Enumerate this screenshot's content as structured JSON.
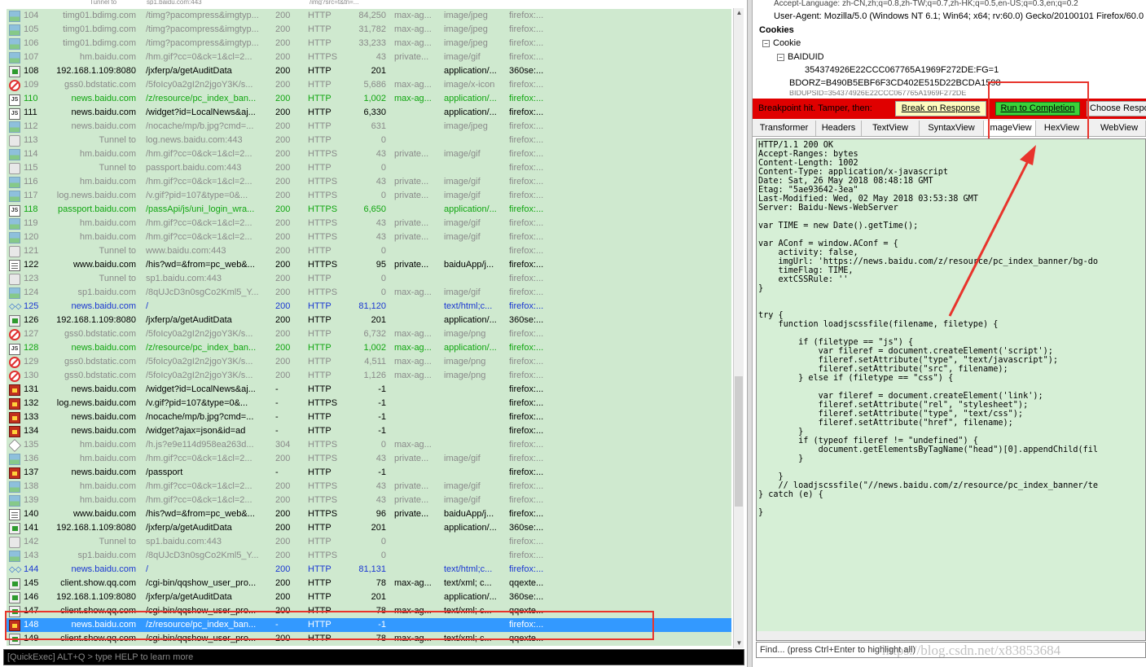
{
  "top_cut": [
    "Tunnel to",
    "sp1.baidu.com:443",
    "/img?src=t&tn=..."
  ],
  "sessions": [
    {
      "num": "104",
      "host": "timg01.bdimg.com",
      "url": "/timg?pacompress&imgtyp...",
      "result": "200",
      "protocol": "HTTP",
      "body": "84,250",
      "caching": "max-ag...",
      "ctype": "image/jpeg",
      "process": "firefox:...",
      "icon": "img",
      "style": "gry"
    },
    {
      "num": "105",
      "host": "timg01.bdimg.com",
      "url": "/timg?pacompress&imgtyp...",
      "result": "200",
      "protocol": "HTTP",
      "body": "31,782",
      "caching": "max-ag...",
      "ctype": "image/jpeg",
      "process": "firefox:...",
      "icon": "img",
      "style": "gry"
    },
    {
      "num": "106",
      "host": "timg01.bdimg.com",
      "url": "/timg?pacompress&imgtyp...",
      "result": "200",
      "protocol": "HTTP",
      "body": "33,233",
      "caching": "max-ag...",
      "ctype": "image/jpeg",
      "process": "firefox:...",
      "icon": "img",
      "style": "gry"
    },
    {
      "num": "107",
      "host": "hm.baidu.com",
      "url": "/hm.gif?cc=0&ck=1&cl=2...",
      "result": "200",
      "protocol": "HTTPS",
      "body": "43",
      "caching": "private...",
      "ctype": "image/gif",
      "process": "firefox:...",
      "icon": "img",
      "style": "gry"
    },
    {
      "num": "108",
      "host": "192.168.1.109:8080",
      "url": "/jxferp/a/getAuditData",
      "result": "200",
      "protocol": "HTTP",
      "body": "201",
      "caching": "",
      "ctype": "application/...",
      "process": "360se:...",
      "icon": "post",
      "style": "blk"
    },
    {
      "num": "109",
      "host": "gss0.bdstatic.com",
      "url": "/5foIcy0a2gI2n2jgoY3K/s...",
      "result": "200",
      "protocol": "HTTP",
      "body": "5,686",
      "caching": "max-ag...",
      "ctype": "image/x-icon",
      "process": "firefox:...",
      "icon": "blocked",
      "style": "gry"
    },
    {
      "num": "110",
      "host": "news.baidu.com",
      "url": "/z/resource/pc_index_ban...",
      "result": "200",
      "protocol": "HTTP",
      "body": "1,002",
      "caching": "max-ag...",
      "ctype": "application/...",
      "process": "firefox:...",
      "icon": "js",
      "style": "grn"
    },
    {
      "num": "111",
      "host": "news.baidu.com",
      "url": "/widget?id=LocalNews&aj...",
      "result": "200",
      "protocol": "HTTP",
      "body": "6,330",
      "caching": "",
      "ctype": "application/...",
      "process": "firefox:...",
      "icon": "js",
      "style": "blk"
    },
    {
      "num": "112",
      "host": "news.baidu.com",
      "url": "/nocache/mp/b.jpg?cmd=...",
      "result": "200",
      "protocol": "HTTP",
      "body": "631",
      "caching": "",
      "ctype": "image/jpeg",
      "process": "firefox:...",
      "icon": "img",
      "style": "gry"
    },
    {
      "num": "113",
      "host": "Tunnel to",
      "url": "log.news.baidu.com:443",
      "result": "200",
      "protocol": "HTTP",
      "body": "0",
      "caching": "",
      "ctype": "",
      "process": "firefox:...",
      "icon": "lock",
      "style": "gry"
    },
    {
      "num": "114",
      "host": "hm.baidu.com",
      "url": "/hm.gif?cc=0&ck=1&cl=2...",
      "result": "200",
      "protocol": "HTTPS",
      "body": "43",
      "caching": "private...",
      "ctype": "image/gif",
      "process": "firefox:...",
      "icon": "img",
      "style": "gry"
    },
    {
      "num": "115",
      "host": "Tunnel to",
      "url": "passport.baidu.com:443",
      "result": "200",
      "protocol": "HTTP",
      "body": "0",
      "caching": "",
      "ctype": "",
      "process": "firefox:...",
      "icon": "lock",
      "style": "gry"
    },
    {
      "num": "116",
      "host": "hm.baidu.com",
      "url": "/hm.gif?cc=0&ck=1&cl=2...",
      "result": "200",
      "protocol": "HTTPS",
      "body": "43",
      "caching": "private...",
      "ctype": "image/gif",
      "process": "firefox:...",
      "icon": "img",
      "style": "gry"
    },
    {
      "num": "117",
      "host": "log.news.baidu.com",
      "url": "/v.gif?pid=107&type=0&...",
      "result": "200",
      "protocol": "HTTPS",
      "body": "0",
      "caching": "private...",
      "ctype": "image/gif",
      "process": "firefox:...",
      "icon": "img",
      "style": "gry"
    },
    {
      "num": "118",
      "host": "passport.baidu.com",
      "url": "/passApi/js/uni_login_wra...",
      "result": "200",
      "protocol": "HTTPS",
      "body": "6,650",
      "caching": "",
      "ctype": "application/...",
      "process": "firefox:...",
      "icon": "js",
      "style": "grn"
    },
    {
      "num": "119",
      "host": "hm.baidu.com",
      "url": "/hm.gif?cc=0&ck=1&cl=2...",
      "result": "200",
      "protocol": "HTTPS",
      "body": "43",
      "caching": "private...",
      "ctype": "image/gif",
      "process": "firefox:...",
      "icon": "img",
      "style": "gry"
    },
    {
      "num": "120",
      "host": "hm.baidu.com",
      "url": "/hm.gif?cc=0&ck=1&cl=2...",
      "result": "200",
      "protocol": "HTTPS",
      "body": "43",
      "caching": "private...",
      "ctype": "image/gif",
      "process": "firefox:...",
      "icon": "img",
      "style": "gry"
    },
    {
      "num": "121",
      "host": "Tunnel to",
      "url": "www.baidu.com:443",
      "result": "200",
      "protocol": "HTTP",
      "body": "0",
      "caching": "",
      "ctype": "",
      "process": "firefox:...",
      "icon": "lock",
      "style": "gry"
    },
    {
      "num": "122",
      "host": "www.baidu.com",
      "url": "/his?wd=&from=pc_web&...",
      "result": "200",
      "protocol": "HTTPS",
      "body": "95",
      "caching": "private...",
      "ctype": "baiduApp/j...",
      "process": "firefox:...",
      "icon": "doc",
      "style": "blk"
    },
    {
      "num": "123",
      "host": "Tunnel to",
      "url": "sp1.baidu.com:443",
      "result": "200",
      "protocol": "HTTP",
      "body": "0",
      "caching": "",
      "ctype": "",
      "process": "firefox:...",
      "icon": "lock",
      "style": "gry"
    },
    {
      "num": "124",
      "host": "sp1.baidu.com",
      "url": "/8qUJcD3n0sgCo2Kml5_Y...",
      "result": "200",
      "protocol": "HTTPS",
      "body": "0",
      "caching": "max-ag...",
      "ctype": "image/gif",
      "process": "firefox:...",
      "icon": "img",
      "style": "gry"
    },
    {
      "num": "125",
      "host": "news.baidu.com",
      "url": "/",
      "result": "200",
      "protocol": "HTTP",
      "body": "81,120",
      "caching": "",
      "ctype": "text/html;c...",
      "process": "firefox:...",
      "icon": "html",
      "style": "blu"
    },
    {
      "num": "126",
      "host": "192.168.1.109:8080",
      "url": "/jxferp/a/getAuditData",
      "result": "200",
      "protocol": "HTTP",
      "body": "201",
      "caching": "",
      "ctype": "application/...",
      "process": "360se:...",
      "icon": "post",
      "style": "blk"
    },
    {
      "num": "127",
      "host": "gss0.bdstatic.com",
      "url": "/5foIcy0a2gI2n2jgoY3K/s...",
      "result": "200",
      "protocol": "HTTP",
      "body": "6,732",
      "caching": "max-ag...",
      "ctype": "image/png",
      "process": "firefox:...",
      "icon": "blocked",
      "style": "gry"
    },
    {
      "num": "128",
      "host": "news.baidu.com",
      "url": "/z/resource/pc_index_ban...",
      "result": "200",
      "protocol": "HTTP",
      "body": "1,002",
      "caching": "max-ag...",
      "ctype": "application/...",
      "process": "firefox:...",
      "icon": "js",
      "style": "grn"
    },
    {
      "num": "129",
      "host": "gss0.bdstatic.com",
      "url": "/5foIcy0a2gI2n2jgoY3K/s...",
      "result": "200",
      "protocol": "HTTP",
      "body": "4,511",
      "caching": "max-ag...",
      "ctype": "image/png",
      "process": "firefox:...",
      "icon": "blocked",
      "style": "gry"
    },
    {
      "num": "130",
      "host": "gss0.bdstatic.com",
      "url": "/5foIcy0a2gI2n2jgoY3K/s...",
      "result": "200",
      "protocol": "HTTP",
      "body": "1,126",
      "caching": "max-ag...",
      "ctype": "image/png",
      "process": "firefox:...",
      "icon": "blocked",
      "style": "gry"
    },
    {
      "num": "131",
      "host": "news.baidu.com",
      "url": "/widget?id=LocalNews&aj...",
      "result": "-",
      "protocol": "HTTP",
      "body": "-1",
      "caching": "",
      "ctype": "",
      "process": "firefox:...",
      "icon": "bp",
      "style": "blk"
    },
    {
      "num": "132",
      "host": "log.news.baidu.com",
      "url": "/v.gif?pid=107&type=0&...",
      "result": "-",
      "protocol": "HTTPS",
      "body": "-1",
      "caching": "",
      "ctype": "",
      "process": "firefox:...",
      "icon": "bp",
      "style": "blk"
    },
    {
      "num": "133",
      "host": "news.baidu.com",
      "url": "/nocache/mp/b.jpg?cmd=...",
      "result": "-",
      "protocol": "HTTP",
      "body": "-1",
      "caching": "",
      "ctype": "",
      "process": "firefox:...",
      "icon": "bp",
      "style": "blk"
    },
    {
      "num": "134",
      "host": "news.baidu.com",
      "url": "/widget?ajax=json&id=ad",
      "result": "-",
      "protocol": "HTTP",
      "body": "-1",
      "caching": "",
      "ctype": "",
      "process": "firefox:...",
      "icon": "bp",
      "style": "blk"
    },
    {
      "num": "135",
      "host": "hm.baidu.com",
      "url": "/h.js?e9e114d958ea263d...",
      "result": "304",
      "protocol": "HTTPS",
      "body": "0",
      "caching": "max-ag...",
      "ctype": "",
      "process": "firefox:...",
      "icon": "304",
      "style": "gry"
    },
    {
      "num": "136",
      "host": "hm.baidu.com",
      "url": "/hm.gif?cc=0&ck=1&cl=2...",
      "result": "200",
      "protocol": "HTTPS",
      "body": "43",
      "caching": "private...",
      "ctype": "image/gif",
      "process": "firefox:...",
      "icon": "img",
      "style": "gry"
    },
    {
      "num": "137",
      "host": "news.baidu.com",
      "url": "/passport",
      "result": "-",
      "protocol": "HTTP",
      "body": "-1",
      "caching": "",
      "ctype": "",
      "process": "firefox:...",
      "icon": "bp",
      "style": "blk"
    },
    {
      "num": "138",
      "host": "hm.baidu.com",
      "url": "/hm.gif?cc=0&ck=1&cl=2...",
      "result": "200",
      "protocol": "HTTPS",
      "body": "43",
      "caching": "private...",
      "ctype": "image/gif",
      "process": "firefox:...",
      "icon": "img",
      "style": "gry"
    },
    {
      "num": "139",
      "host": "hm.baidu.com",
      "url": "/hm.gif?cc=0&ck=1&cl=2...",
      "result": "200",
      "protocol": "HTTPS",
      "body": "43",
      "caching": "private...",
      "ctype": "image/gif",
      "process": "firefox:...",
      "icon": "img",
      "style": "gry"
    },
    {
      "num": "140",
      "host": "www.baidu.com",
      "url": "/his?wd=&from=pc_web&...",
      "result": "200",
      "protocol": "HTTPS",
      "body": "96",
      "caching": "private...",
      "ctype": "baiduApp/j...",
      "process": "firefox:...",
      "icon": "doc",
      "style": "blk"
    },
    {
      "num": "141",
      "host": "192.168.1.109:8080",
      "url": "/jxferp/a/getAuditData",
      "result": "200",
      "protocol": "HTTP",
      "body": "201",
      "caching": "",
      "ctype": "application/...",
      "process": "360se:...",
      "icon": "post",
      "style": "blk"
    },
    {
      "num": "142",
      "host": "Tunnel to",
      "url": "sp1.baidu.com:443",
      "result": "200",
      "protocol": "HTTP",
      "body": "0",
      "caching": "",
      "ctype": "",
      "process": "firefox:...",
      "icon": "lock",
      "style": "gry"
    },
    {
      "num": "143",
      "host": "sp1.baidu.com",
      "url": "/8qUJcD3n0sgCo2Kml5_Y...",
      "result": "200",
      "protocol": "HTTPS",
      "body": "0",
      "caching": "",
      "ctype": "",
      "process": "firefox:...",
      "icon": "img",
      "style": "gry"
    },
    {
      "num": "144",
      "host": "news.baidu.com",
      "url": "/",
      "result": "200",
      "protocol": "HTTP",
      "body": "81,131",
      "caching": "",
      "ctype": "text/html;c...",
      "process": "firefox:...",
      "icon": "html",
      "style": "blu"
    },
    {
      "num": "145",
      "host": "client.show.qq.com",
      "url": "/cgi-bin/qqshow_user_pro...",
      "result": "200",
      "protocol": "HTTP",
      "body": "78",
      "caching": "max-ag...",
      "ctype": "text/xml; c...",
      "process": "qqexte...",
      "icon": "post",
      "style": "blk"
    },
    {
      "num": "146",
      "host": "192.168.1.109:8080",
      "url": "/jxferp/a/getAuditData",
      "result": "200",
      "protocol": "HTTP",
      "body": "201",
      "caching": "",
      "ctype": "application/...",
      "process": "360se:...",
      "icon": "post",
      "style": "blk"
    },
    {
      "num": "147",
      "host": "client.show.qq.com",
      "url": "/cgi-bin/qqshow_user_pro...",
      "result": "200",
      "protocol": "HTTP",
      "body": "78",
      "caching": "max-ag...",
      "ctype": "text/xml; c...",
      "process": "qqexte...",
      "icon": "post",
      "style": "blk"
    },
    {
      "num": "148",
      "host": "news.baidu.com",
      "url": "/z/resource/pc_index_ban...",
      "result": "-",
      "protocol": "HTTP",
      "body": "-1",
      "caching": "",
      "ctype": "",
      "process": "firefox:...",
      "icon": "bp",
      "style": "sel"
    },
    {
      "num": "149",
      "host": "client.show.qq.com",
      "url": "/cgi-bin/qqshow_user_pro...",
      "result": "200",
      "protocol": "HTTP",
      "body": "78",
      "caching": "max-ag...",
      "ctype": "text/xml; c...",
      "process": "qqexte...",
      "icon": "post",
      "style": "blk"
    }
  ],
  "quickexec": {
    "placeholder": "[QuickExec] ALT+Q > type HELP to learn more"
  },
  "request_headers": {
    "accept_language_cut": "Accept-Language: zh-CN,zh;q=0.8,zh-TW;q=0.7,zh-HK;q=0.5,en-US;q=0.3,en;q=0.2",
    "user_agent": "User-Agent: Mozilla/5.0 (Windows NT 6.1; Win64; x64; rv:60.0) Gecko/20100101 Firefox/60.0",
    "cookies_heading": "Cookies",
    "cookie_node": "Cookie",
    "baiduid_node": "BAIDUID",
    "baiduid_value": "354374926E22CCC067765A1969F272DE:FG=1",
    "bdorz_value": "BDORZ=B490B5EBF6F3CD402E515D22BCDA1598",
    "cut_line": "BIDUPSID=354374926E22CCC067765A1969F272DE"
  },
  "breakpoint": {
    "label": "Breakpoint hit. Tamper, then:",
    "break_on_response": "Break on Response",
    "run_to_completion": "Run to Completion",
    "choose_response": "Choose Respo"
  },
  "tabs": [
    "Transformer",
    "Headers",
    "TextView",
    "SyntaxView",
    "ImageView",
    "HexView",
    "WebView"
  ],
  "response_text": "HTTP/1.1 200 OK\nAccept-Ranges: bytes\nContent-Length: 1002\nContent-Type: application/x-javascript\nDate: Sat, 26 May 2018 08:48:18 GMT\nEtag: \"5ae93642-3ea\"\nLast-Modified: Wed, 02 May 2018 03:53:38 GMT\nServer: Baidu-News-WebServer\n\nvar TIME = new Date().getTime();\n\nvar AConf = window.AConf = {\n    activity: false,\n    imgUrl: 'https://news.baidu.com/z/resource/pc_index_banner/bg-do\n    timeFlag: TIME,\n    extCSSRule: ''\n}\n\n\ntry {\n    function loadjscssfile(filename, filetype) {\n\n        if (filetype == \"js\") {\n            var fileref = document.createElement('script');\n            fileref.setAttribute(\"type\", \"text/javascript\");\n            fileref.setAttribute(\"src\", filename);\n        } else if (filetype == \"css\") {\n\n            var fileref = document.createElement('link');\n            fileref.setAttribute(\"rel\", \"stylesheet\");\n            fileref.setAttribute(\"type\", \"text/css\");\n            fileref.setAttribute(\"href\", filename);\n        }\n        if (typeof fileref != \"undefined\") {\n            document.getElementsByTagName(\"head\")[0].appendChild(fil\n        }\n\n    }\n    // loadjscssfile(\"//news.baidu.com/z/resource/pc_index_banner/te\n} catch (e) {\n\n}",
  "find": {
    "placeholder": "Find... (press Ctrl+Enter to highlight all)"
  },
  "watermark": "https://blog.csdn.net/x83853684",
  "colors": {
    "row_bg": "#cfe9cf",
    "selected_bg": "#3399ff",
    "breakpoint_bar": "#e00000",
    "run_button": "#3ad23a",
    "annotation": "#e8342c"
  }
}
